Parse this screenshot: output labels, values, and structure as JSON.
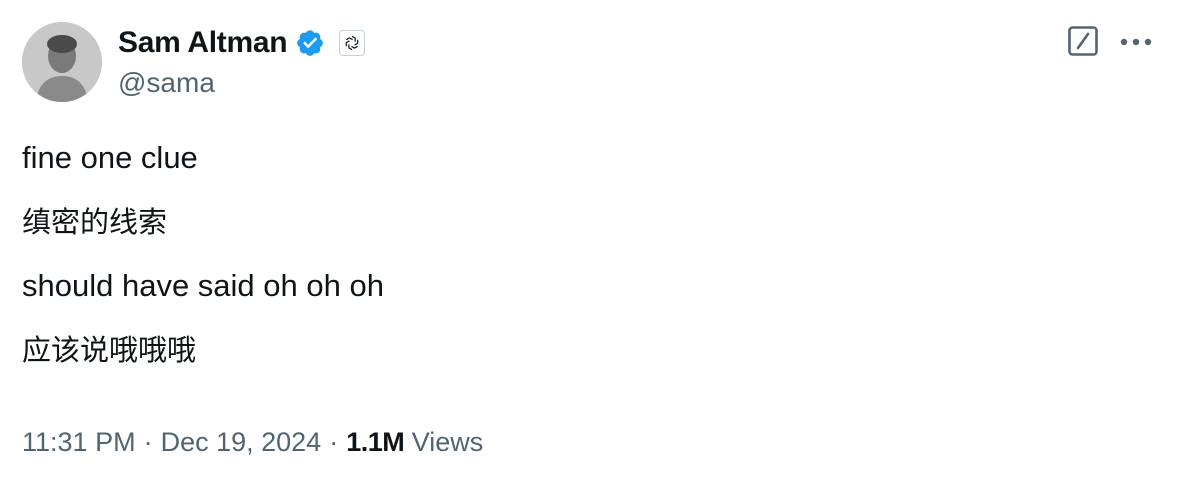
{
  "author": {
    "display_name": "Sam Altman",
    "handle": "@sama",
    "verified_icon": "verified-badge-icon",
    "affiliation_icon": "openai-logo-icon",
    "colors": {
      "verified": "#1d9bf0",
      "secondary_text": "#536471",
      "primary_text": "#0f1419"
    }
  },
  "actions": {
    "grok_icon": "grok-icon",
    "more_icon": "more-horizontal-icon"
  },
  "tweet": {
    "lines": [
      "fine one clue",
      "缜密的线索",
      "should have said oh oh oh",
      "应该说哦哦哦"
    ]
  },
  "meta": {
    "time": "11:31 PM",
    "separator": "·",
    "date": "Dec 19, 2024",
    "views_count": "1.1M",
    "views_label": "Views"
  }
}
